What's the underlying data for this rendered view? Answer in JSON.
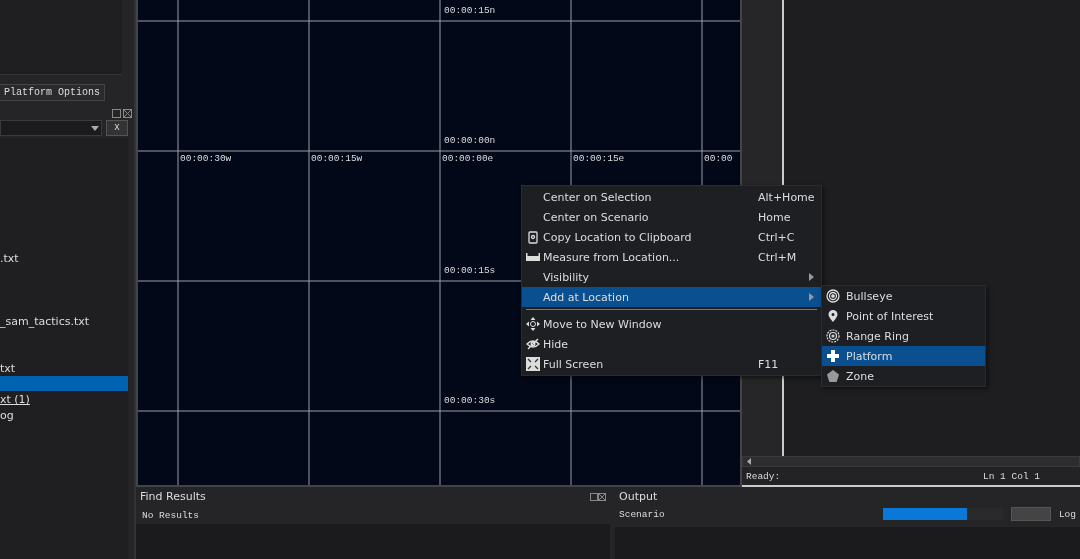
{
  "left_panel": {
    "tabs": [
      {
        "label": "Platform Options",
        "selected": true
      }
    ],
    "clear_button": "X",
    "files": [
      {
        "name": ".txt",
        "selected": false,
        "kind": "file"
      },
      {
        "name": "_sam_tactics.txt",
        "selected": false,
        "kind": "file"
      },
      {
        "name": "txt",
        "selected": false,
        "kind": "file"
      },
      {
        "selected": true,
        "kind": "file"
      },
      {
        "name": "xt (1)",
        "selected": false,
        "kind": "link"
      },
      {
        "name": "og",
        "selected": false,
        "kind": "file"
      }
    ]
  },
  "map": {
    "lat_labels": [
      "00:00:15n",
      "00:00:00n",
      "00:00:15s",
      "00:00:30s"
    ],
    "lon_labels": [
      "00:00:30w",
      "00:00:15w",
      "00:00:00e",
      "00:00:15e",
      "00:00"
    ]
  },
  "context_menu": {
    "items": [
      {
        "kind": "item",
        "label": "Center on Selection",
        "shortcut": "Alt+Home",
        "selected": false
      },
      {
        "kind": "item",
        "label": "Center on Scenario",
        "shortcut": "Home",
        "selected": false
      },
      {
        "kind": "item",
        "label": "Copy Location to Clipboard",
        "shortcut": "Ctrl+C",
        "selected": false
      },
      {
        "kind": "item",
        "label": "Measure from Location...",
        "shortcut": "Ctrl+M",
        "selected": false
      },
      {
        "kind": "submenu",
        "label": "Visibility",
        "selected": false
      },
      {
        "kind": "submenu",
        "label": "Add at Location",
        "selected": true
      },
      {
        "kind": "separator"
      },
      {
        "kind": "item",
        "label": "Move to New Window",
        "selected": false
      },
      {
        "kind": "item",
        "label": "Hide",
        "selected": false
      },
      {
        "kind": "item",
        "label": "Full Screen",
        "shortcut": "F11",
        "selected": false
      }
    ]
  },
  "submenu": {
    "items": [
      {
        "label": "Bullseye",
        "selected": false
      },
      {
        "label": "Point of Interest",
        "selected": false
      },
      {
        "label": "Range Ring",
        "selected": false
      },
      {
        "label": "Platform",
        "selected": true
      },
      {
        "label": "Zone",
        "selected": false
      }
    ]
  },
  "editor": {
    "status": "Ready:",
    "position": "Ln 1 Col 1"
  },
  "find_results": {
    "title": "Find Results",
    "message": "No Results"
  },
  "output": {
    "title": "Output",
    "tab": "Scenario",
    "progress": {
      "level": 0.7
    },
    "tab_2": "Log"
  }
}
